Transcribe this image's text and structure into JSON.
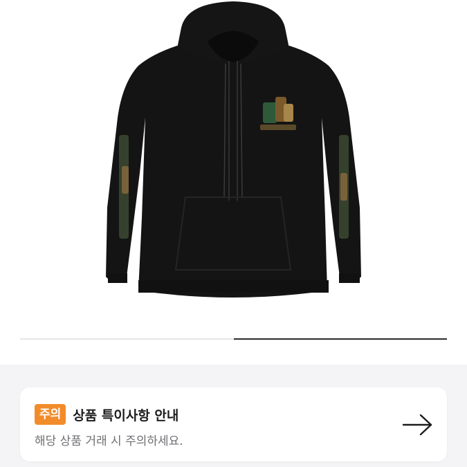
{
  "product": {
    "image_alt": "black zip hoodie with embroidered sleeve graphics"
  },
  "image_slider": {
    "current_fraction": 0.5
  },
  "notice": {
    "badge": "주의",
    "title": "상품 특이사항 안내",
    "subtitle": "해당 상품 거래 시 주의하세요."
  },
  "colors": {
    "accent": "#f28c2a",
    "panel_bg": "#f4f4f6",
    "hoodie": "#141414"
  }
}
